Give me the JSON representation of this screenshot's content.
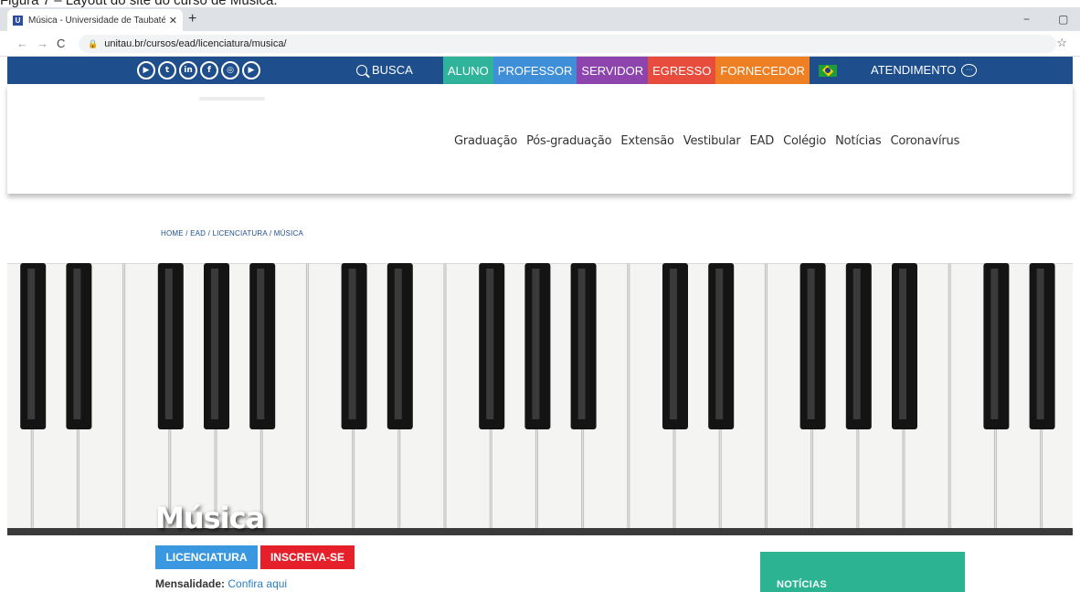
{
  "caption": "Figura 7 – Layout do site do curso de Música.",
  "browser": {
    "tab_title": "Música - Universidade de Taubaté",
    "close_glyph": "✕",
    "newtab_glyph": "+",
    "url": "unitau.br/cursos/ead/licenciatura/musica/",
    "back_glyph": "←",
    "forward_glyph": "→",
    "reload_glyph": "C",
    "star_glyph": "☆",
    "minimize_glyph": "−",
    "restore_glyph": "▢"
  },
  "topbar": {
    "social_icons": [
      {
        "name": "youtube-icon",
        "glyph": "▶"
      },
      {
        "name": "twitter-icon",
        "glyph": "t"
      },
      {
        "name": "linkedin-icon",
        "glyph": "in"
      },
      {
        "name": "facebook-icon",
        "glyph": "f"
      },
      {
        "name": "instagram-icon",
        "glyph": "◎"
      },
      {
        "name": "youtube-icon",
        "glyph": "▶"
      }
    ],
    "search_label": "BUSCA",
    "roles": [
      {
        "label": "ALUNO",
        "color": "#2fb39a"
      },
      {
        "label": "PROFESSOR",
        "color": "#3f8fd8"
      },
      {
        "label": "SERVIDOR",
        "color": "#8e44ad"
      },
      {
        "label": "EGRESSO",
        "color": "#e74c3c"
      },
      {
        "label": "FORNECEDOR",
        "color": "#ee7f22"
      }
    ],
    "atendimento_label": "ATENDIMENTO",
    "bar_color": "#1f4e8c"
  },
  "nav": {
    "items": [
      "Graduação",
      "Pós-graduação",
      "Extensão",
      "Vestibular",
      "EAD",
      "Colégio",
      "Notícias",
      "Coronavírus"
    ]
  },
  "breadcrumb": {
    "items": [
      "HOME",
      "EAD",
      "LICENCIATURA",
      "MÚSICA"
    ],
    "separator": " / "
  },
  "hero": {
    "title": "Música"
  },
  "actions": {
    "licenciatura_label": "LICENCIATURA",
    "inscreva_label": "INSCREVA-SE"
  },
  "mensalidade": {
    "label": "Mensalidade:",
    "link": "Confira aqui"
  },
  "sidebar": {
    "noticias_label": "NOTÍCIAS",
    "color": "#2cb392"
  }
}
